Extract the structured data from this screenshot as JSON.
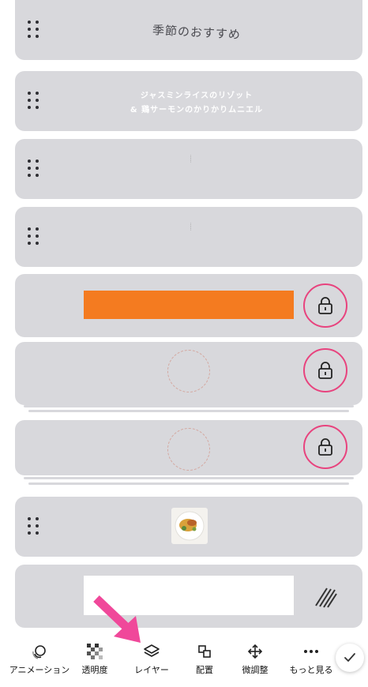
{
  "layers": [
    {
      "id": "title",
      "text": "季節のおすすめ"
    },
    {
      "id": "dish-name",
      "line1": "ジャスミンライスのリゾット",
      "line2": "& 鶏サーモンのかりかりムニエル"
    },
    {
      "id": "small-text-1",
      "text": "……"
    },
    {
      "id": "small-text-2",
      "text": "……"
    },
    {
      "id": "orange-bar",
      "color": "#f47b20",
      "locked": true
    },
    {
      "id": "circle-1",
      "locked": true
    },
    {
      "id": "circle-2",
      "locked": true
    },
    {
      "id": "food-photo"
    },
    {
      "id": "white-frame"
    }
  ],
  "colors": {
    "accent": "#e8437e",
    "orange": "#f47b20",
    "layer_bg": "#d8d8dc",
    "arrow": "#f0489a"
  },
  "toolbar": {
    "items": [
      {
        "label": "アニメーション",
        "icon": "animation-icon"
      },
      {
        "label": "透明度",
        "icon": "transparency-icon"
      },
      {
        "label": "レイヤー",
        "icon": "layers-icon"
      },
      {
        "label": "配置",
        "icon": "position-icon"
      },
      {
        "label": "微調整",
        "icon": "nudge-icon"
      },
      {
        "label": "もっと見る",
        "icon": "more-icon"
      }
    ],
    "confirm_icon": "checkmark-icon"
  }
}
